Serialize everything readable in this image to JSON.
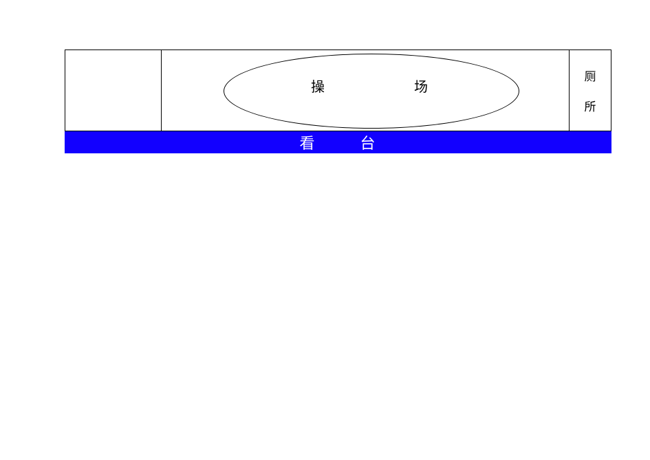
{
  "diagram": {
    "field_label": "操　　场",
    "toilet_char1": "厕",
    "toilet_char2": "所",
    "stand_label": "看　台"
  },
  "watermark": {
    "left": "",
    "right": ""
  }
}
